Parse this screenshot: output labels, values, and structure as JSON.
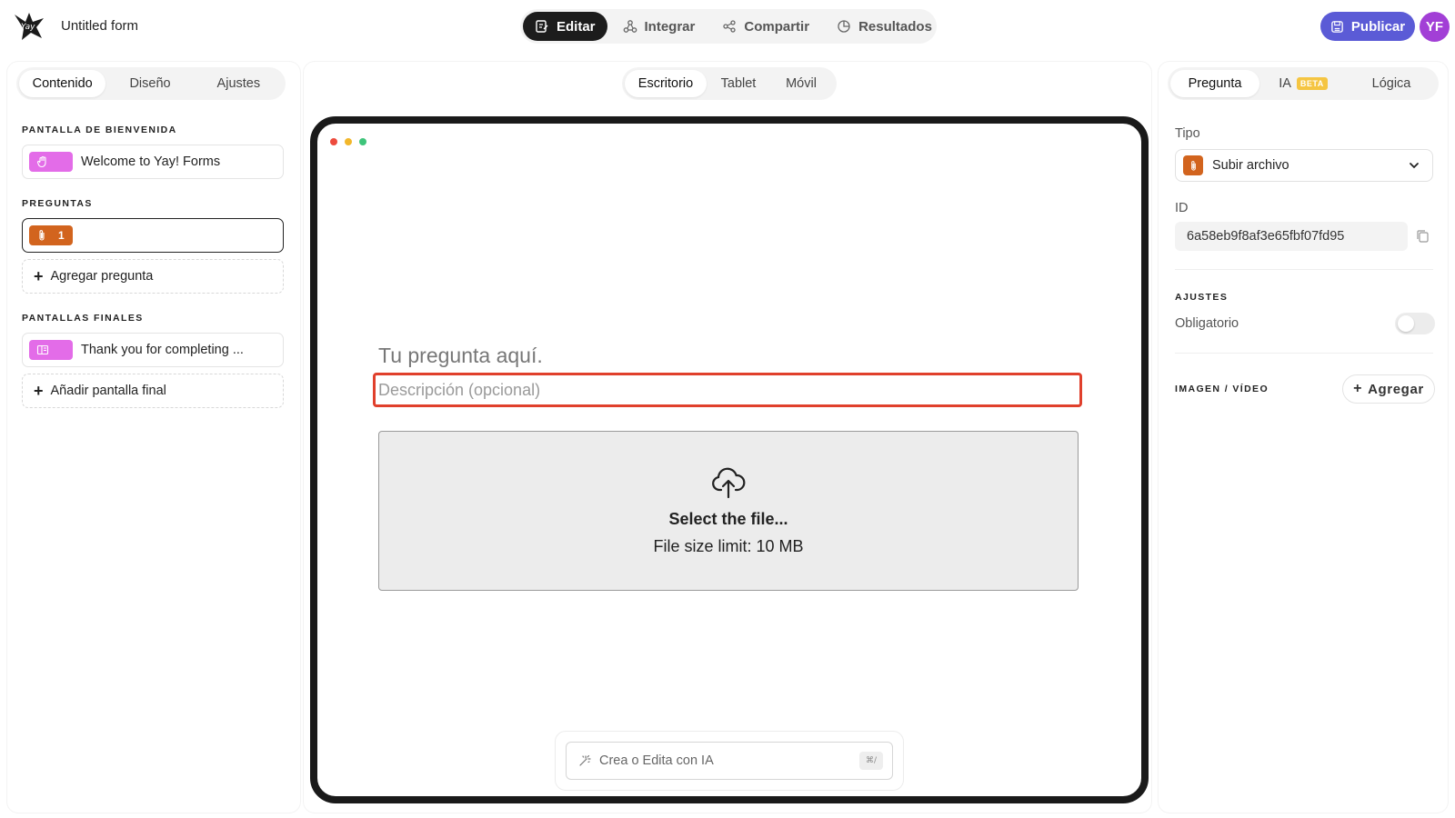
{
  "header": {
    "form_title": "Untitled form",
    "tabs": [
      {
        "label": "Editar",
        "icon": "edit-icon",
        "active": true
      },
      {
        "label": "Integrar",
        "icon": "integrate-icon",
        "active": false
      },
      {
        "label": "Compartir",
        "icon": "share-icon",
        "active": false
      },
      {
        "label": "Resultados",
        "icon": "results-icon",
        "active": false
      }
    ],
    "publish_label": "Publicar",
    "avatar_initials": "YF"
  },
  "left": {
    "tabs": [
      "Contenido",
      "Diseño",
      "Ajustes"
    ],
    "active_tab": "Contenido",
    "welcome_section": "PANTALLA DE BIENVENIDA",
    "welcome_item": "Welcome to Yay! Forms",
    "questions_section": "PREGUNTAS",
    "question_number": "1",
    "add_question": "Agregar pregunta",
    "end_section": "PANTALLAS FINALES",
    "end_item": "Thank you for completing ...",
    "add_end": "Añadir pantalla final"
  },
  "center": {
    "device_tabs": [
      "Escritorio",
      "Tablet",
      "Móvil"
    ],
    "active_device": "Escritorio",
    "question_placeholder": "Tu pregunta aquí.",
    "description_placeholder": "Descripción (opcional)",
    "upload_title": "Select the file...",
    "upload_limit": "File size limit: 10 MB",
    "ai_placeholder": "Crea o Edita con IA",
    "ai_shortcut": "⌘/"
  },
  "right": {
    "tabs": [
      "Pregunta",
      "IA",
      "Lógica"
    ],
    "beta_badge": "BETA",
    "active_tab": "Pregunta",
    "type_label": "Tipo",
    "type_value": "Subir archivo",
    "id_label": "ID",
    "id_value": "6a58eb9f8af3e65fbf07fd95",
    "settings_section": "AJUSTES",
    "required_label": "Obligatorio",
    "required_on": false,
    "media_section": "IMAGEN / VÍDEO",
    "add_media": "Agregar"
  },
  "colors": {
    "accent": "#5b5bd6",
    "avatar": "#a23fd6",
    "welcome_chip": "#e36ce8",
    "question_chip": "#d2641e",
    "highlight": "#e0402c"
  }
}
